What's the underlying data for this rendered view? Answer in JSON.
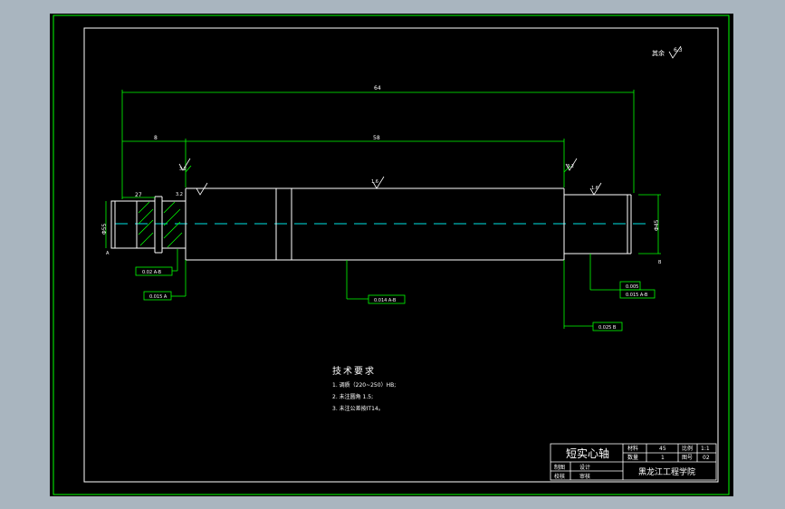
{
  "drawing": {
    "rough_symbol_global": "其余",
    "dims": {
      "overall_len": "64",
      "seg_left": "8",
      "seg_main": "58",
      "len_27": "27",
      "dia_left": "Φ55",
      "dia_right": "Φ45"
    },
    "roughness": {
      "r1": "3.2",
      "r2": "3.2",
      "r3": "1.6",
      "r4": "3.2",
      "r5": "1.6",
      "global": "6.3"
    },
    "tolerance_frames": {
      "t1": "0.02 A-B",
      "t2": "0.015 A",
      "t3": "0.014 A-B",
      "t4a": "0.005",
      "t4b": "0.015 A-B",
      "t5": "0.025 B"
    },
    "datum": {
      "a": "A",
      "b": "B"
    }
  },
  "tech_requirements": {
    "title": "技术要求",
    "items": [
      "1. 调质（220~250）HB;",
      "2. 未注圆角 1.5;",
      "3. 未注公差按IT14。"
    ]
  },
  "title_block": {
    "part_name": "短实心轴",
    "school": "黑龙江工程学院",
    "material_label": "材料",
    "scale_label": "比例",
    "scale_value": "1:1",
    "qty_label": "数量",
    "qty_value": "1",
    "sheet_label": "图号",
    "sheet_value": "02",
    "designer_label": "设计",
    "checker_label": "审核",
    "review_label": "校核",
    "drawn_label": "制图",
    "material_value": "45"
  },
  "colors": {
    "frame": "#00ff00",
    "line": "#ffffff",
    "center": "#00e5e5",
    "background": "#000000",
    "page": "#a9b5bf"
  }
}
